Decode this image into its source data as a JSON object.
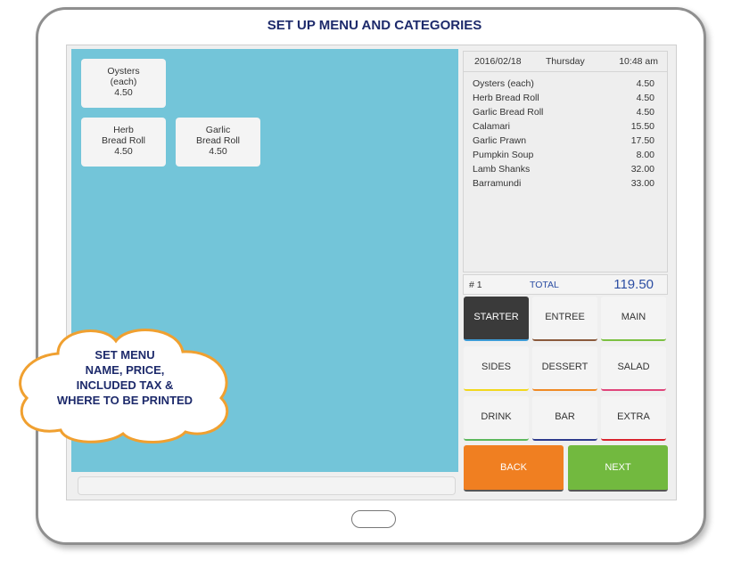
{
  "title": "SET UP MENU AND CATEGORIES",
  "items": [
    {
      "name1": "Oysters",
      "name2": "(each)",
      "price": "4.50"
    },
    {
      "name1": "Herb",
      "name2": "Bread Roll",
      "price": "4.50"
    },
    {
      "name1": "Garlic",
      "name2": "Bread Roll",
      "price": "4.50"
    }
  ],
  "receipt": {
    "date": "2016/02/18",
    "day": "Thursday",
    "time": "10:48 am",
    "lines": [
      {
        "name": "Oysters (each)",
        "price": "4.50"
      },
      {
        "name": "Herb Bread Roll",
        "price": "4.50"
      },
      {
        "name": "Garlic Bread Roll",
        "price": "4.50"
      },
      {
        "name": "Calamari",
        "price": "15.50"
      },
      {
        "name": "Garlic Prawn",
        "price": "17.50"
      },
      {
        "name": "Pumpkin Soup",
        "price": "8.00"
      },
      {
        "name": "Lamb Shanks",
        "price": "32.00"
      },
      {
        "name": "Barramundi",
        "price": "33.00"
      }
    ],
    "order_no": "# 1",
    "total_label": "TOTAL",
    "total": "119.50"
  },
  "categories": [
    {
      "label": "STARTER",
      "color": "#3d9bd6",
      "selected": true
    },
    {
      "label": "ENTREE",
      "color": "#8b5a3c"
    },
    {
      "label": "MAIN",
      "color": "#7cc142"
    },
    {
      "label": "SIDES",
      "color": "#f2d81c"
    },
    {
      "label": "DESSERT",
      "color": "#f08a24"
    },
    {
      "label": "SALAD",
      "color": "#e0457b"
    },
    {
      "label": "DRINK",
      "color": "#5cb85c"
    },
    {
      "label": "BAR",
      "color": "#2d3a8c"
    },
    {
      "label": "EXTRA",
      "color": "#d9232d"
    }
  ],
  "nav": {
    "back": "BACK",
    "next": "NEXT",
    "back_color": "#f07f21",
    "next_color": "#72b93f"
  },
  "cloud": {
    "line1": "SET MENU",
    "line2": "NAME, PRICE,",
    "line3": "INCLUDED TAX &",
    "line4": "WHERE TO BE PRINTED"
  },
  "colors": {
    "menu_area": "#73c5d9",
    "cloud_border": "#f0a030",
    "selected_category": "#3a3a3a",
    "total_value": "#2c4ea3"
  }
}
